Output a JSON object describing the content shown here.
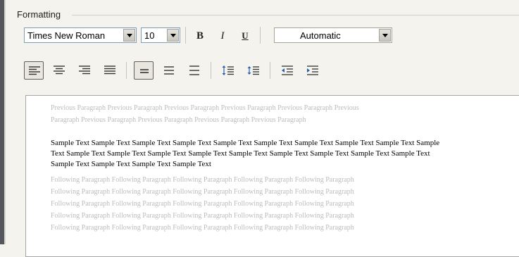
{
  "group": {
    "title": "Formatting"
  },
  "toolbar": {
    "font_name": "Times New Roman",
    "font_size": "10",
    "bold_label": "B",
    "italic_label": "I",
    "underline_label": "U",
    "color_value": "Automatic"
  },
  "icons": {
    "align_left": "align-left-icon",
    "align_center": "align-center-icon",
    "align_right": "align-right-icon",
    "justify": "justify-icon",
    "single_spacing": "single-spacing-icon",
    "onehalf_spacing": "one-and-half-spacing-icon",
    "double_spacing": "double-spacing-icon",
    "increase_para_spacing": "increase-paragraph-spacing-icon",
    "decrease_para_spacing": "decrease-paragraph-spacing-icon",
    "decrease_indent": "decrease-indent-icon",
    "increase_indent": "increase-indent-icon"
  },
  "preview": {
    "previous_lines": [
      "Previous Paragraph Previous Paragraph Previous Paragraph Previous Paragraph Previous Paragraph Previous",
      "Paragraph Previous Paragraph Previous Paragraph Previous Paragraph Previous Paragraph"
    ],
    "sample_lines": [
      "Sample Text Sample Text Sample Text Sample Text Sample Text Sample Text Sample Text Sample Text Sample Text Sample",
      "Text Sample Text Sample Text Sample Text Sample Text Sample Text Sample Text Sample Text Sample Text Sample Text",
      "Sample Text Sample Text Sample Text Sample Text"
    ],
    "following_lines": [
      "Following Paragraph Following Paragraph Following Paragraph Following Paragraph Following Paragraph",
      "Following Paragraph Following Paragraph Following Paragraph Following Paragraph Following Paragraph",
      "Following Paragraph Following Paragraph Following Paragraph Following Paragraph Following Paragraph",
      "Following Paragraph Following Paragraph Following Paragraph Following Paragraph Following Paragraph",
      "Following Paragraph Following Paragraph Following Paragraph Following Paragraph Following Paragraph"
    ]
  },
  "colors": {
    "background": "#f4f3ee",
    "combo_border": "#7f9db9",
    "preview_ghost_text": "#bcbcbc"
  }
}
